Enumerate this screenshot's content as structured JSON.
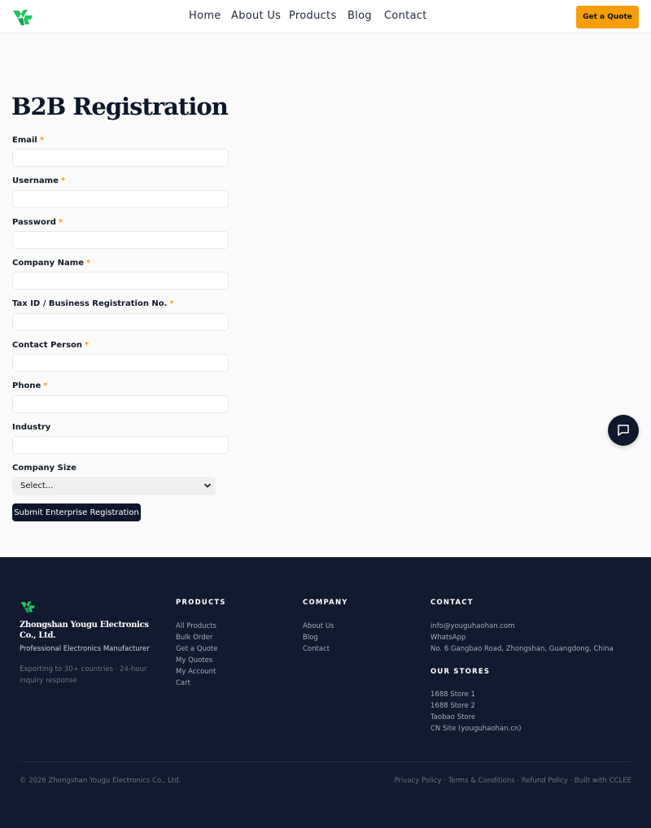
{
  "header": {
    "nav": [
      "Home",
      "About Us",
      "Products",
      "Blog",
      "Contact"
    ],
    "cta": "Get a Quote"
  },
  "form": {
    "title": "B2B Registration",
    "fields": [
      {
        "label": "Email",
        "required": "*",
        "value": ""
      },
      {
        "label": "Username",
        "required": "*",
        "value": ""
      },
      {
        "label": "Password",
        "required": "*",
        "value": ""
      },
      {
        "label": "Company Name",
        "required": "*",
        "value": ""
      },
      {
        "label": "Tax ID / Business Registration No.",
        "required": "*",
        "value": ""
      },
      {
        "label": "Contact Person",
        "required": "*",
        "value": ""
      },
      {
        "label": "Phone",
        "required": "*",
        "value": ""
      },
      {
        "label": "Industry",
        "required": "",
        "value": ""
      }
    ],
    "company_size_label": "Company Size",
    "company_size_value": "Select...",
    "submit": "Submit Enterprise Registration"
  },
  "footer": {
    "company_name": "Zhongshan Yougu Electronics Co., Ltd.",
    "tagline": "Professional Electronics Manufacturer",
    "description": "Exporting to 30+ countries · 24-hour inquiry response",
    "products_heading": "PRODUCTS",
    "products": [
      "All Products",
      "Bulk Order",
      "Get a Quote",
      "My Quotes",
      "My Account",
      "Cart"
    ],
    "company_heading": "COMPANY",
    "company_links": [
      "About Us",
      "Blog",
      "Contact"
    ],
    "contact_heading": "CONTACT",
    "contact": [
      "info@youguhaohan.com",
      "WhatsApp",
      "No. 6 Gangbao Road, Zhongshan, Guangdong, China"
    ],
    "stores_heading": "OUR STORES",
    "stores": [
      "1688 Store 1",
      "1688 Store 2",
      "Taobao Store",
      "CN Site (youguhaohan.cn)"
    ],
    "copyright": "© 2026 Zhongshan Yougu Electronics Co., Ltd.",
    "legal": "Privacy Policy · Terms & Conditions · Refund Policy · Built with CCLEE"
  },
  "colors": {
    "accent": "#f59e0b",
    "navy": "#0f172a",
    "logo_green": "#22c55e"
  },
  "icons": {
    "logo": "yougu-logo-icon",
    "chat": "chat-bubble-icon",
    "select": "chevron-down-icon"
  }
}
